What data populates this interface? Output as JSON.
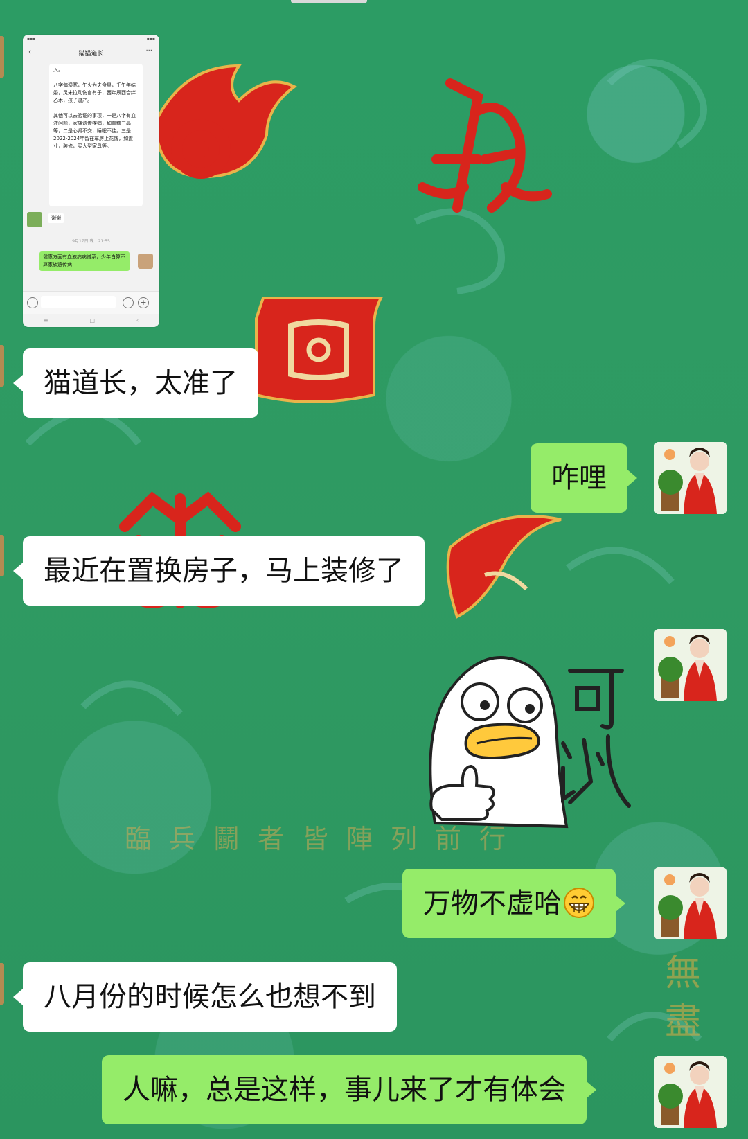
{
  "chat": {
    "image_message": {
      "header_title": "猫猫道长",
      "card_text": "入。\n\n八字偏湿寒，午火为夫食星，壬午年结婚，灵未拉动伤官有子，酉年辰酉合绊乙木，孩子流产。\n\n其他可以去验证的事项，一是八字有血液问题，家族遗传疾病，如血糖三高等，二是心肾不交，睡眠不佳。三是2022-2024年留在车房上花钱，如置业，装修，买大型家具等。",
      "reply_text": "谢谢",
      "timestamp_text": "9月17日 晚上21:55",
      "green_text": "健康方面有血液病病谱系，少年白算不算家族遗传病"
    },
    "messages": [
      {
        "side": "left",
        "text": "猫道长，太准了"
      },
      {
        "side": "right",
        "text": "咋哩"
      },
      {
        "side": "left",
        "text": "最近在置换房子，马上装修了"
      },
      {
        "side": "right",
        "type": "sticker",
        "sticker_text": "可以"
      },
      {
        "side": "right",
        "text": "万物不虚哈",
        "emoji": "grinning-face-emoji"
      },
      {
        "side": "left",
        "text": "八月份的时候怎么也想不到"
      },
      {
        "side": "right",
        "text": "人嘛，总是这样，事儿来了才有体会"
      }
    ]
  },
  "wallpaper": {
    "motto": "臨兵鬭者皆陣列前行",
    "side_text": "無盡"
  },
  "colors": {
    "background": "#2e9a63",
    "bubble_right": "#95ec69",
    "bubble_left": "#ffffff",
    "glyph_red": "#d8251c",
    "glyph_gold": "#e9b44a"
  }
}
